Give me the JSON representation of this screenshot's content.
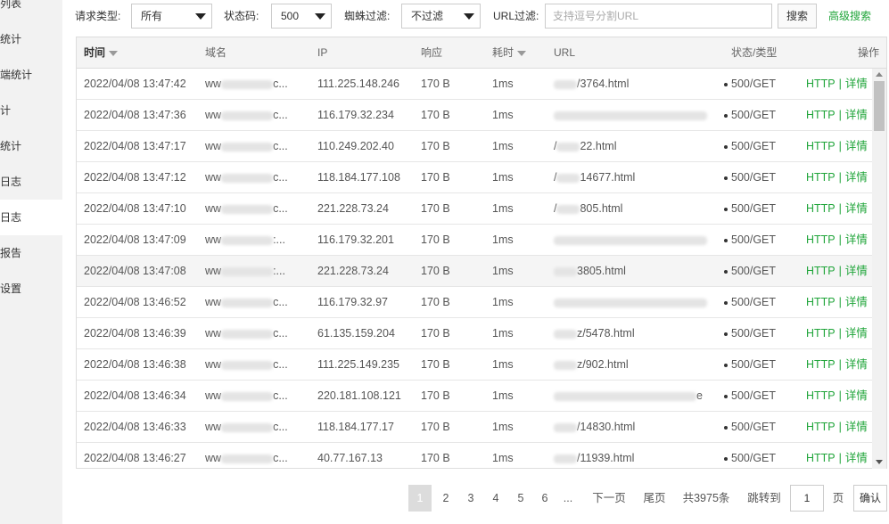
{
  "sidebar": {
    "items": [
      {
        "label": "列表",
        "active": false
      },
      {
        "label": "统计",
        "active": false
      },
      {
        "label": "端统计",
        "active": false
      },
      {
        "label": "计",
        "active": false
      },
      {
        "label": "统计",
        "active": false
      },
      {
        "label": "日志",
        "active": false
      },
      {
        "label": "日志",
        "active": true
      },
      {
        "label": "报告",
        "active": false
      },
      {
        "label": "设置",
        "active": false
      }
    ]
  },
  "filters": {
    "request_type_label": "请求类型:",
    "request_type_value": "所有",
    "status_code_label": "状态码:",
    "status_code_value": "500",
    "spider_label": "蜘蛛过滤:",
    "spider_value": "不过滤",
    "url_label": "URL过滤:",
    "url_placeholder": "支持逗号分割URL",
    "search_label": "搜索",
    "advanced_label": "高级搜索"
  },
  "table": {
    "headers": {
      "time": "时间",
      "domain": "域名",
      "ip": "IP",
      "response": "响应",
      "duration": "耗时",
      "url": "URL",
      "status": "状态/类型",
      "action": "操作"
    },
    "rows": [
      {
        "time": "2022/04/08 13:47:42",
        "domain_prefix": "ww",
        "domain_suffix": "c...",
        "ip": "111.225.148.246",
        "size": "170 B",
        "duration": "1ms",
        "url_prefix": "",
        "url_suffix": "/3764.html",
        "status": "500/GET",
        "http": "HTTP",
        "detail": "详情"
      },
      {
        "time": "2022/04/08 13:47:36",
        "domain_prefix": "ww",
        "domain_suffix": "c...",
        "ip": "116.179.32.234",
        "size": "170 B",
        "duration": "1ms",
        "url_prefix": "",
        "url_suffix": "",
        "status": "500/GET",
        "http": "HTTP",
        "detail": "详情"
      },
      {
        "time": "2022/04/08 13:47:17",
        "domain_prefix": "ww",
        "domain_suffix": "c...",
        "ip": "110.249.202.40",
        "size": "170 B",
        "duration": "1ms",
        "url_prefix": "/",
        "url_suffix": "22.html",
        "status": "500/GET",
        "http": "HTTP",
        "detail": "详情"
      },
      {
        "time": "2022/04/08 13:47:12",
        "domain_prefix": "ww",
        "domain_suffix": "c...",
        "ip": "118.184.177.108",
        "size": "170 B",
        "duration": "1ms",
        "url_prefix": "/",
        "url_suffix": "14677.html",
        "status": "500/GET",
        "http": "HTTP",
        "detail": "详情"
      },
      {
        "time": "2022/04/08 13:47:10",
        "domain_prefix": "ww",
        "domain_suffix": "c...",
        "ip": "221.228.73.24",
        "size": "170 B",
        "duration": "1ms",
        "url_prefix": "/",
        "url_suffix": "805.html",
        "status": "500/GET",
        "http": "HTTP",
        "detail": "详情"
      },
      {
        "time": "2022/04/08 13:47:09",
        "domain_prefix": "ww",
        "domain_suffix": ":...",
        "ip": "116.179.32.201",
        "size": "170 B",
        "duration": "1ms",
        "url_prefix": "",
        "url_suffix": "",
        "status": "500/GET",
        "http": "HTTP",
        "detail": "详情"
      },
      {
        "time": "2022/04/08 13:47:08",
        "domain_prefix": "ww",
        "domain_suffix": ":...",
        "ip": "221.228.73.24",
        "size": "170 B",
        "duration": "1ms",
        "url_prefix": "",
        "url_suffix": "3805.html",
        "status": "500/GET",
        "http": "HTTP",
        "detail": "详情"
      },
      {
        "time": "2022/04/08 13:46:52",
        "domain_prefix": "ww",
        "domain_suffix": "c...",
        "ip": "116.179.32.97",
        "size": "170 B",
        "duration": "1ms",
        "url_prefix": "",
        "url_suffix": "",
        "status": "500/GET",
        "http": "HTTP",
        "detail": "详情"
      },
      {
        "time": "2022/04/08 13:46:39",
        "domain_prefix": "ww",
        "domain_suffix": "c...",
        "ip": "61.135.159.204",
        "size": "170 B",
        "duration": "1ms",
        "url_prefix": "",
        "url_suffix": "z/5478.html",
        "status": "500/GET",
        "http": "HTTP",
        "detail": "详情"
      },
      {
        "time": "2022/04/08 13:46:38",
        "domain_prefix": "ww",
        "domain_suffix": "c...",
        "ip": "111.225.149.235",
        "size": "170 B",
        "duration": "1ms",
        "url_prefix": "",
        "url_suffix": "z/902.html",
        "status": "500/GET",
        "http": "HTTP",
        "detail": "详情"
      },
      {
        "time": "2022/04/08 13:46:34",
        "domain_prefix": "ww",
        "domain_suffix": "c...",
        "ip": "220.181.108.121",
        "size": "170 B",
        "duration": "1ms",
        "url_prefix": "",
        "url_suffix": "e",
        "status": "500/GET",
        "http": "HTTP",
        "detail": "详情"
      },
      {
        "time": "2022/04/08 13:46:33",
        "domain_prefix": "ww",
        "domain_suffix": "c...",
        "ip": "118.184.177.17",
        "size": "170 B",
        "duration": "1ms",
        "url_prefix": "",
        "url_suffix": "/14830.html",
        "status": "500/GET",
        "http": "HTTP",
        "detail": "详情"
      },
      {
        "time": "2022/04/08 13:46:27",
        "domain_prefix": "ww",
        "domain_suffix": "c...",
        "ip": "40.77.167.13",
        "size": "170 B",
        "duration": "1ms",
        "url_prefix": "",
        "url_suffix": "/11939.html",
        "status": "500/GET",
        "http": "HTTP",
        "detail": "详情"
      }
    ]
  },
  "pagination": {
    "pages": [
      "1",
      "2",
      "3",
      "4",
      "5",
      "6"
    ],
    "current": "1",
    "ellipsis": "...",
    "next": "下一页",
    "last": "尾页",
    "total": "共3975条",
    "jump_label": "跳转到",
    "jump_value": "1",
    "page_unit": "页",
    "confirm": "确认"
  },
  "colors": {
    "accent": "#20a53a",
    "header_bg": "#f4f4f4",
    "sidebar_bg": "#f2f2f2"
  }
}
